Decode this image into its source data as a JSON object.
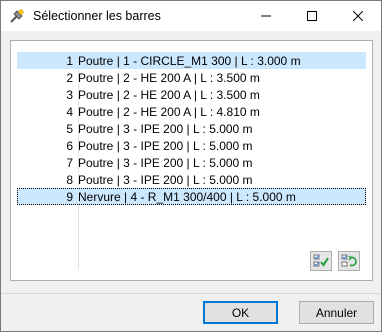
{
  "window": {
    "title": "Sélectionner les barres"
  },
  "title_controls": {
    "minimize": "minimize-icon",
    "maximize": "maximize-icon",
    "close": "close-icon"
  },
  "list": {
    "items": [
      {
        "num": "1",
        "text": "Poutre | 1 - CIRCLE_M1 300 | L : 3.000 m",
        "selected": true
      },
      {
        "num": "2",
        "text": "Poutre | 2 - HE 200 A | L : 3.500 m"
      },
      {
        "num": "3",
        "text": "Poutre | 2 - HE 200 A | L : 3.500 m"
      },
      {
        "num": "4",
        "text": "Poutre | 2 - HE 200 A | L : 4.810 m"
      },
      {
        "num": "5",
        "text": "Poutre | 3 - IPE 200 | L : 5.000 m"
      },
      {
        "num": "6",
        "text": "Poutre | 3 - IPE 200 | L : 5.000 m"
      },
      {
        "num": "7",
        "text": "Poutre | 3 - IPE 200 | L : 5.000 m"
      },
      {
        "num": "8",
        "text": "Poutre | 3 - IPE 200 | L : 5.000 m"
      },
      {
        "num": "9",
        "text": "Nervure | 4 - R_M1 300/400 | L : 5.000 m",
        "selected": true,
        "focused": true
      }
    ]
  },
  "toolbar": {
    "select_all_icon": "check-all-icon",
    "invert_icon": "invert-selection-icon"
  },
  "buttons": {
    "ok": "OK",
    "cancel": "Annuler"
  },
  "colors": {
    "selection": "#cce8ff",
    "accent": "#0078d7"
  }
}
